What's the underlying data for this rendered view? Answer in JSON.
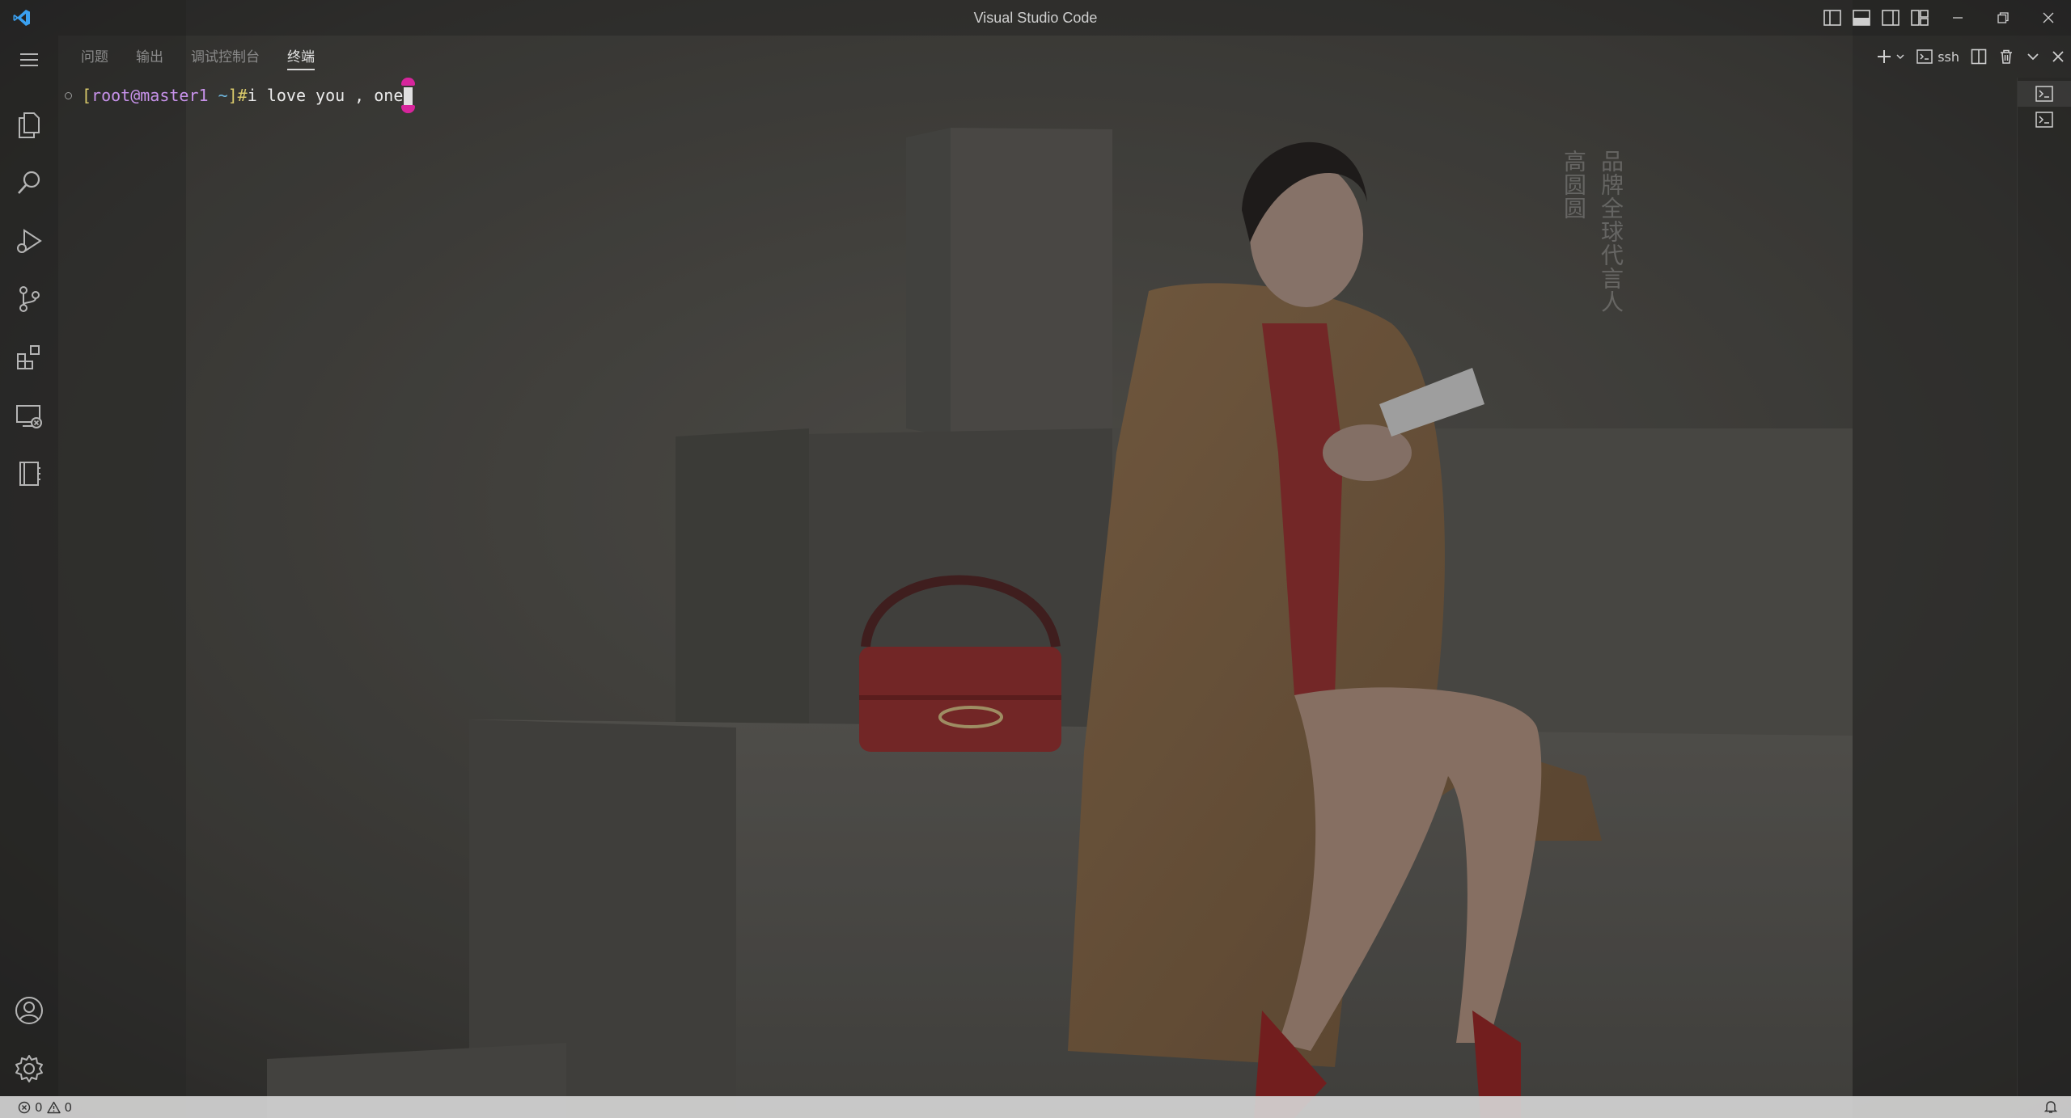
{
  "window": {
    "title": "Visual Studio Code"
  },
  "panel": {
    "tabs": [
      {
        "label": "问题"
      },
      {
        "label": "输出"
      },
      {
        "label": "调试控制台"
      },
      {
        "label": "终端",
        "active": true
      }
    ],
    "actions": {
      "terminal_name": "ssh"
    }
  },
  "terminal": {
    "prompt_open": "[",
    "prompt_user": "root@master1",
    "prompt_dir": " ~",
    "prompt_close": "]#",
    "command": "i love you , one"
  },
  "watermark": {
    "column1": "品牌全球代言人",
    "column2": "高圆圆"
  },
  "statusbar": {
    "errors": "0",
    "warnings": "0"
  },
  "colors": {
    "accent_vscode_blue": "#3aa0f0",
    "cursor_magenta": "#d6259c",
    "prompt_user": "#c792ea",
    "prompt_bracket": "#d9c96a"
  }
}
